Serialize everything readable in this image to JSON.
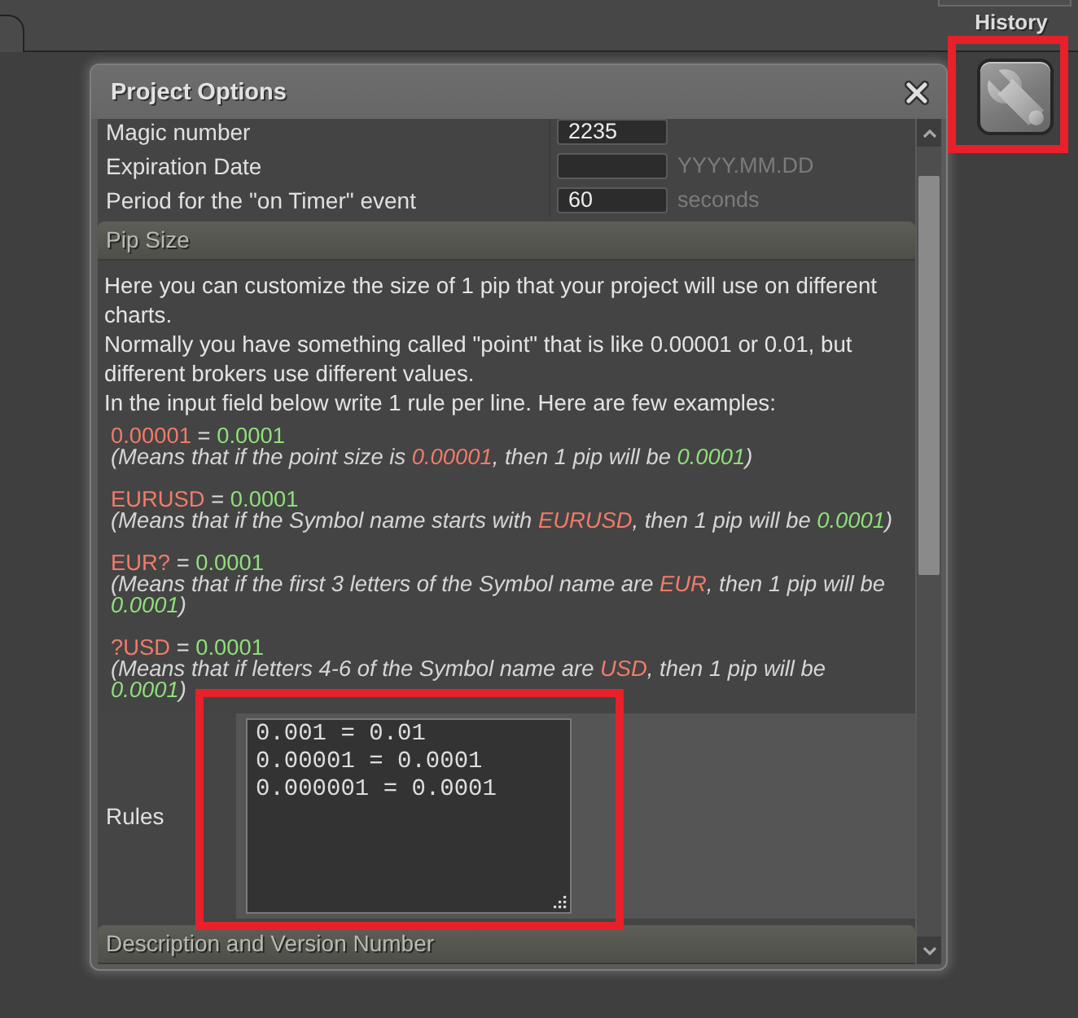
{
  "side_panel": {
    "title": "History",
    "tool_button": {
      "highlighted": true
    }
  },
  "dialog": {
    "title": "Project Options",
    "fields": [
      {
        "label": "Magic number",
        "value": "2235"
      },
      {
        "label": "Expiration Date",
        "hint": "YYYY.MM.DD"
      },
      {
        "label": "Period for the \"on Timer\" event",
        "value": "60",
        "hint": "seconds"
      }
    ],
    "sections": [
      {
        "title": "Pip Size",
        "paragraphs": [
          "Here you can customize the size of 1 pip that your project will use on different charts.",
          "Normally you have something called \"point\" that is like 0.00001 or 0.01, but different brokers use different values.",
          "In the input field below write 1 rule per line. Here are few examples:"
        ],
        "examples": [
          {
            "rule": [
              {
                "text": "0.00001",
                "kind": "pattern"
              },
              {
                "text": " = ",
                "kind": "plain"
              },
              {
                "text": "0.0001",
                "kind": "pip"
              }
            ],
            "explanation": [
              {
                "text": "(Means that if the point size is ",
                "kind": "plain"
              },
              {
                "text": "0.00001",
                "kind": "pattern"
              },
              {
                "text": ", then 1 pip will be ",
                "kind": "plain"
              },
              {
                "text": "0.0001",
                "kind": "pip"
              },
              {
                "text": ")",
                "kind": "plain"
              }
            ]
          },
          {
            "rule": [
              {
                "text": "EURUSD",
                "kind": "pattern"
              },
              {
                "text": " = ",
                "kind": "plain"
              },
              {
                "text": "0.0001",
                "kind": "pip"
              }
            ],
            "explanation": [
              {
                "text": "(Means that if the Symbol name starts with ",
                "kind": "plain"
              },
              {
                "text": "EURUSD",
                "kind": "pattern"
              },
              {
                "text": ", then 1 pip will be ",
                "kind": "plain"
              },
              {
                "text": "0.0001",
                "kind": "pip"
              },
              {
                "text": ")",
                "kind": "plain"
              }
            ]
          },
          {
            "rule": [
              {
                "text": "EUR?",
                "kind": "pattern"
              },
              {
                "text": " = ",
                "kind": "plain"
              },
              {
                "text": "0.0001",
                "kind": "pip"
              }
            ],
            "explanation": [
              {
                "text": "(Means that if the first 3 letters of the Symbol name are ",
                "kind": "plain"
              },
              {
                "text": "EUR",
                "kind": "pattern"
              },
              {
                "text": ", then 1 pip will be ",
                "kind": "plain"
              },
              {
                "text": "0.0001",
                "kind": "pip"
              },
              {
                "text": ")",
                "kind": "plain"
              }
            ]
          },
          {
            "rule": [
              {
                "text": "?USD",
                "kind": "pattern"
              },
              {
                "text": " = ",
                "kind": "plain"
              },
              {
                "text": "0.0001",
                "kind": "pip"
              }
            ],
            "explanation": [
              {
                "text": "(Means that if letters 4-6 of the Symbol name are ",
                "kind": "plain"
              },
              {
                "text": "USD",
                "kind": "pattern"
              },
              {
                "text": ", then 1 pip will be ",
                "kind": "plain"
              },
              {
                "text": "0.0001",
                "kind": "pip"
              },
              {
                "text": ")",
                "kind": "plain"
              }
            ]
          }
        ],
        "rules": {
          "label": "Rules",
          "value": "0.001 = 0.01\n0.00001 = 0.0001\n0.000001 = 0.0001",
          "highlighted": true
        }
      },
      {
        "title": "Description and Version Number"
      }
    ]
  }
}
